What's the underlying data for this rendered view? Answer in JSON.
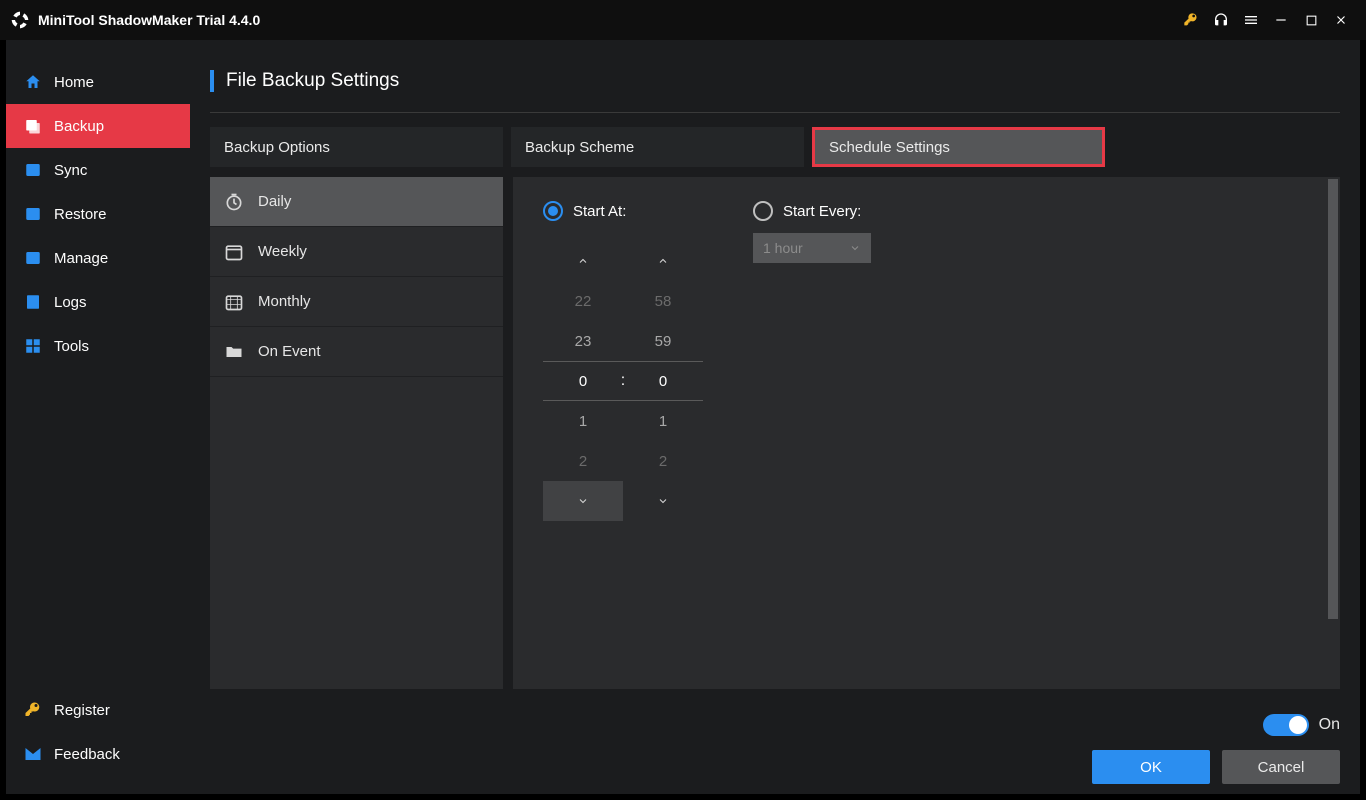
{
  "titlebar": {
    "title": "MiniTool ShadowMaker Trial 4.4.0"
  },
  "sidebar": {
    "items": [
      {
        "label": "Home"
      },
      {
        "label": "Backup"
      },
      {
        "label": "Sync"
      },
      {
        "label": "Restore"
      },
      {
        "label": "Manage"
      },
      {
        "label": "Logs"
      },
      {
        "label": "Tools"
      }
    ],
    "bottom": [
      {
        "label": "Register"
      },
      {
        "label": "Feedback"
      }
    ]
  },
  "page": {
    "title": "File Backup Settings"
  },
  "tabs": [
    {
      "label": "Backup Options"
    },
    {
      "label": "Backup Scheme"
    },
    {
      "label": "Schedule Settings"
    }
  ],
  "freq": [
    {
      "label": "Daily"
    },
    {
      "label": "Weekly"
    },
    {
      "label": "Monthly"
    },
    {
      "label": "On Event"
    }
  ],
  "schedule": {
    "start_at_label": "Start At:",
    "start_every_label": "Start Every:",
    "every_value": "1 hour",
    "time": {
      "hour_minus2": "22",
      "hour_minus1": "23",
      "hour_sel": "0",
      "hour_plus1": "1",
      "hour_plus2": "2",
      "min_minus2": "58",
      "min_minus1": "59",
      "min_sel": "0",
      "min_plus1": "1",
      "min_plus2": "2",
      "sep": ":"
    }
  },
  "footer": {
    "toggle_label": "On",
    "ok": "OK",
    "cancel": "Cancel"
  }
}
